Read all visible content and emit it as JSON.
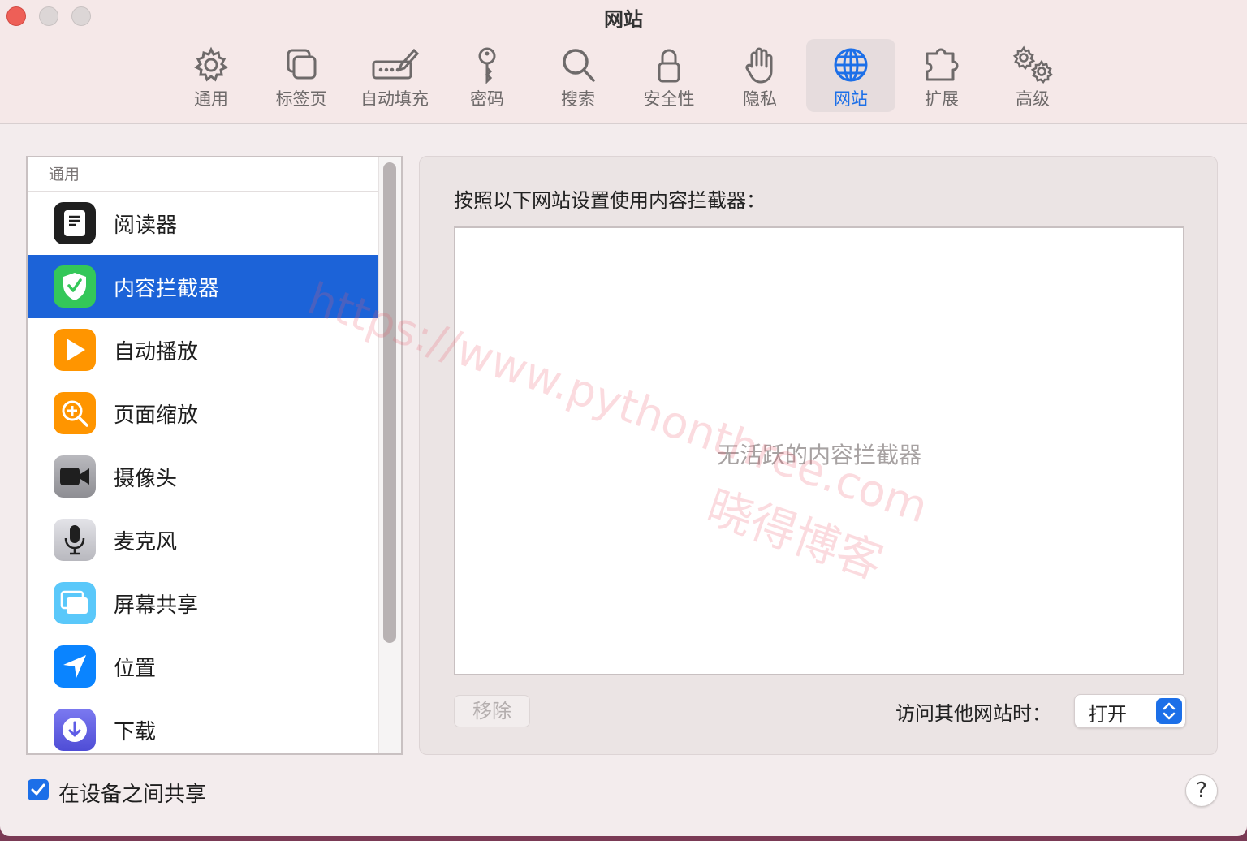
{
  "window": {
    "title": "网站"
  },
  "toolbar": {
    "tabs": [
      {
        "label": "通用",
        "icon": "gear-icon"
      },
      {
        "label": "标签页",
        "icon": "tabs-icon"
      },
      {
        "label": "自动填充",
        "icon": "autofill-pencil-icon"
      },
      {
        "label": "密码",
        "icon": "key-icon"
      },
      {
        "label": "搜索",
        "icon": "magnifier-icon"
      },
      {
        "label": "安全性",
        "icon": "lock-icon"
      },
      {
        "label": "隐私",
        "icon": "hand-icon"
      },
      {
        "label": "网站",
        "icon": "globe-icon",
        "active": true
      },
      {
        "label": "扩展",
        "icon": "puzzle-icon"
      },
      {
        "label": "高级",
        "icon": "gears-icon"
      }
    ],
    "accent_color": "#1c6fe8"
  },
  "sidebar": {
    "header": "通用",
    "items": [
      {
        "label": "阅读器",
        "icon": "reader-icon",
        "color": "#1f1f1f"
      },
      {
        "label": "内容拦截器",
        "icon": "shield-check-icon",
        "color": "#34c759",
        "selected": true
      },
      {
        "label": "自动播放",
        "icon": "play-icon",
        "color": "#ff9500"
      },
      {
        "label": "页面缩放",
        "icon": "zoom-icon",
        "color": "#ff9500"
      },
      {
        "label": "摄像头",
        "icon": "camera-icon",
        "color": "#8e8e93"
      },
      {
        "label": "麦克风",
        "icon": "microphone-icon",
        "color": "#c7c7cc"
      },
      {
        "label": "屏幕共享",
        "icon": "screen-share-icon",
        "color": "#5ac8fa"
      },
      {
        "label": "位置",
        "icon": "location-arrow-icon",
        "color": "#0a84ff"
      },
      {
        "label": "下载",
        "icon": "download-icon",
        "color": "#5e5ce6"
      }
    ]
  },
  "panel": {
    "title": "按照以下网站设置使用内容拦截器：",
    "empty_message": "无活跃的内容拦截器",
    "remove_label": "移除",
    "visit_other_label": "访问其他网站时：",
    "visit_other_value": "打开"
  },
  "footer": {
    "share_label": "在设备之间共享",
    "share_checked": true,
    "help_label": "?"
  },
  "watermark": {
    "url": "https://www.pythonthree.com",
    "name": "晓得博客"
  }
}
